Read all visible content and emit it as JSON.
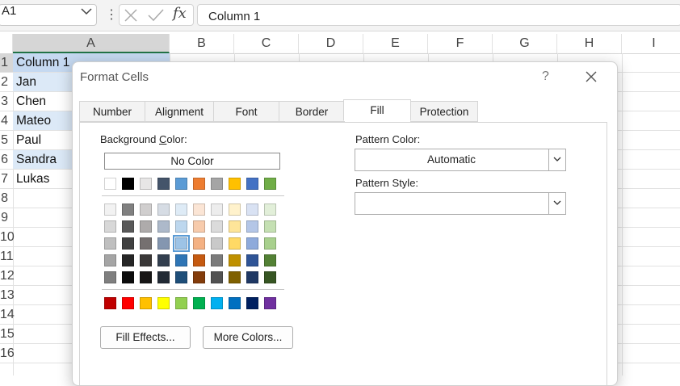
{
  "formula_bar": {
    "name_box": "A1",
    "more_glyph": "⋮",
    "fx_label": "fx",
    "formula_value": "Column 1"
  },
  "grid": {
    "columns": [
      "A",
      "B",
      "C",
      "D",
      "E",
      "F",
      "G",
      "H",
      "I"
    ],
    "row_numbers": [
      "1",
      "2",
      "3",
      "4",
      "5",
      "6",
      "7",
      "8",
      "9",
      "10",
      "11",
      "12",
      "13",
      "14",
      "15",
      "16"
    ],
    "column_a_values": [
      "Column 1",
      "Jan",
      "Chen",
      "Mateo",
      "Paul",
      "Sandra",
      "Lukas"
    ]
  },
  "dialog": {
    "title": "Format Cells",
    "help": "?",
    "tabs": [
      "Number",
      "Alignment",
      "Font",
      "Border",
      "Fill",
      "Protection"
    ],
    "active_tab": "Fill",
    "background_color_label": "Background ",
    "background_color_label_u": "C",
    "background_color_label_rest": "olor:",
    "no_color_button": "No Color",
    "theme_row": [
      "#ffffff",
      "#000000",
      "#e7e6e6",
      "#44546a",
      "#5b9bd5",
      "#ed7d31",
      "#a5a5a5",
      "#ffc000",
      "#4472c4",
      "#70ad47"
    ],
    "shade_rows": [
      [
        "#f2f2f2",
        "#808080",
        "#d0cece",
        "#d6dce4",
        "#deebf6",
        "#fbe5d5",
        "#ededed",
        "#fff2cc",
        "#d9e2f3",
        "#e2efd9"
      ],
      [
        "#d8d8d8",
        "#595959",
        "#aeabab",
        "#adb9ca",
        "#bdd7ee",
        "#f7cbac",
        "#dbdbdb",
        "#fee599",
        "#b4c6e7",
        "#c5e0b3"
      ],
      [
        "#bfbfbf",
        "#404040",
        "#757070",
        "#8496b0",
        "#9dc3e6",
        "#f4b183",
        "#c9c9c9",
        "#ffd965",
        "#8eaadb",
        "#a8d08d"
      ],
      [
        "#a5a5a5",
        "#262626",
        "#3a3838",
        "#323f4f",
        "#2e75b5",
        "#c55a11",
        "#7b7b7b",
        "#bf9000",
        "#2f5496",
        "#538135"
      ],
      [
        "#7f7f7f",
        "#0c0c0c",
        "#171616",
        "#222a35",
        "#1e4e79",
        "#833c0b",
        "#525252",
        "#7f6000",
        "#1f3864",
        "#375623"
      ]
    ],
    "selected_swatch": "row 3, column 5",
    "standard_row": [
      "#c00000",
      "#ff0000",
      "#ffc000",
      "#ffff00",
      "#92d050",
      "#00b050",
      "#00b0f0",
      "#0070c0",
      "#002060",
      "#7030a0"
    ],
    "fill_effects_button": "Fill Effects...",
    "fill_effects_u": "i",
    "more_colors_button": "More Colors...",
    "more_colors_u": "M",
    "pattern_color_label": "Pattern Color:",
    "pattern_color_u": "P",
    "pattern_color_value": "Automatic",
    "pattern_style_label": "Pattern Style:",
    "pattern_style_u": "P",
    "pattern_style_value": ""
  }
}
